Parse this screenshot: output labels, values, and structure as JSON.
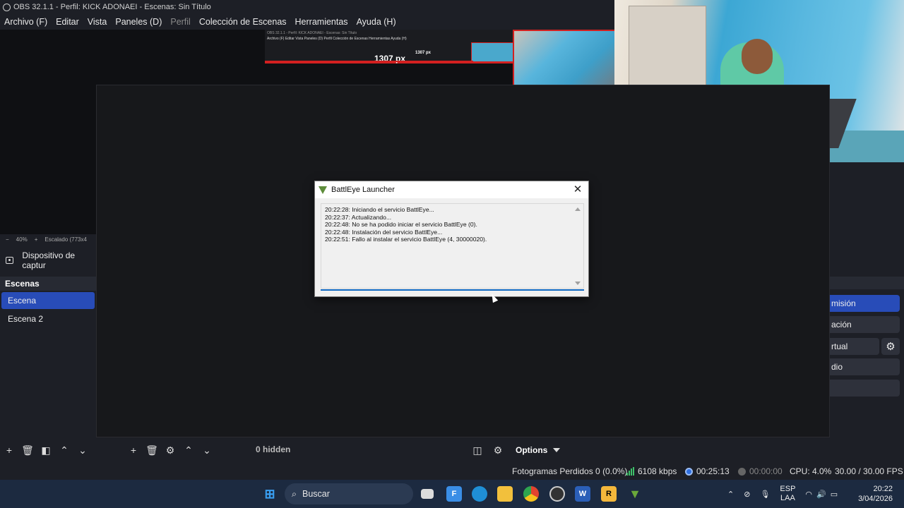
{
  "app": {
    "title": "OBS 32.1.1 - Perfil: KICK ADONAEI - Escenas: Sin Título",
    "menu": [
      "Archivo (F)",
      "Editar",
      "Vista",
      "Paneles (D)",
      "Perfil",
      "Colección de Escenas",
      "Herramientas",
      "Ayuda (H)"
    ]
  },
  "preview": {
    "nested_title": "OBS 32.1.1 - Perfil: KICK ADONAEI - Escenas: Sin Título",
    "nested_menu": "Archivo (F)   Editar   Vista   Paneles (D)   Perfil   Colección de Escenas   Herramientas   Ayuda (H)",
    "px_label": "1307 px",
    "px_label_small": "1307 px",
    "zoom": "40%",
    "scale_text": "Escalado (773x4"
  },
  "source": {
    "label": "Dispositivo de captur"
  },
  "scenes": {
    "header": "Escenas",
    "items": [
      "Escena",
      "Escena 2"
    ]
  },
  "sources_toolbar": {
    "hidden": "0 hidden",
    "options": "Options"
  },
  "controls": {
    "buttons": [
      "misión",
      "ación",
      "rtual",
      "dio"
    ]
  },
  "status": {
    "dropped": "Fotogramas Perdidos 0 (0.0%)",
    "bitrate": "6108 kbps",
    "stream_time": "00:25:13",
    "rec_time": "00:00:00",
    "cpu": "CPU: 4.0%",
    "fps": "30.00 / 30.00 FPS"
  },
  "dialog": {
    "title": "BattlEye Launcher",
    "log": [
      "20:22:28: Iniciando el servicio BattlEye...",
      "20:22:37: Actualizando...",
      "20:22:48: No se ha podido iniciar el servicio BattlEye (0).",
      "20:22:48: Instalación del servicio BattlEye...",
      "20:22:51: Fallo al instalar el servicio BattlEye (4, 30000020)."
    ]
  },
  "taskbar": {
    "search": "Buscar",
    "lang1": "ESP",
    "lang2": "LAA",
    "time": "20:22",
    "date": "3/04/2026"
  },
  "colors": {
    "accent": "#284cb8",
    "bitrate_green": "#3fc26a",
    "stream_blue": "#2f6fe0"
  }
}
